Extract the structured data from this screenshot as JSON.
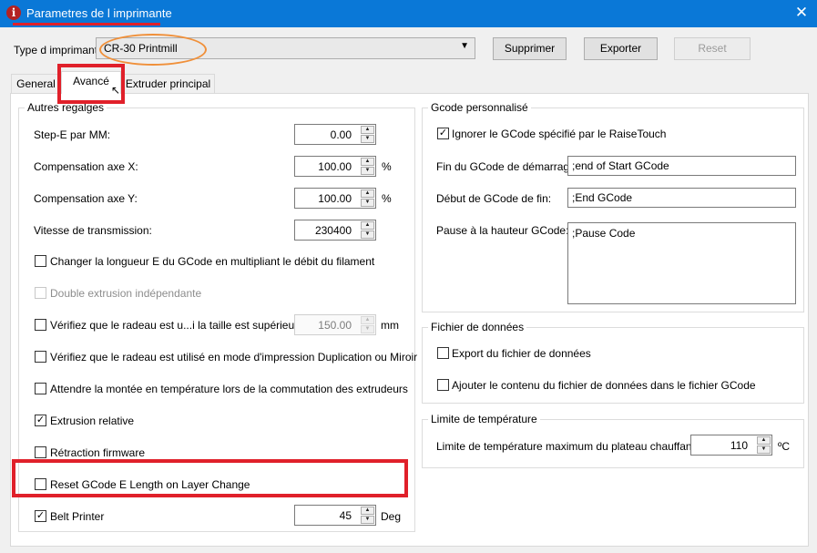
{
  "window": {
    "title": "Parametres de l imprimante",
    "close_glyph": "✕",
    "app_icon_glyph": "i"
  },
  "printer": {
    "label": "Type d imprimante:",
    "selected": "CR-30 Printmill"
  },
  "buttons": {
    "delete": "Supprimer",
    "export": "Exporter",
    "reset": "Reset"
  },
  "tabs": [
    {
      "label": "General"
    },
    {
      "label": "Avancé"
    },
    {
      "label": "Extruder principal"
    }
  ],
  "other_settings": {
    "legend": "Autres regalges",
    "step_e": {
      "label": "Step-E par MM:",
      "value": "0.00"
    },
    "comp_x": {
      "label": "Compensation axe X:",
      "value": "100.00",
      "unit": "%"
    },
    "comp_y": {
      "label": "Compensation axe Y:",
      "value": "100.00",
      "unit": "%"
    },
    "baud": {
      "label": "Vitesse de transmission:",
      "value": "230400"
    },
    "checkboxes": [
      {
        "label": "Changer la longueur E du GCode en multipliant le débit du filament",
        "checked": false,
        "enabled": true
      },
      {
        "label": "Double extrusion indépendante",
        "checked": false,
        "enabled": false
      },
      {
        "label": "Vérifiez que le radeau est u...i la taille est supérieure à",
        "checked": false,
        "enabled": true
      },
      {
        "label": "Vérifiez que le radeau est utilisé en mode d'impression Duplication ou Miroir",
        "checked": false,
        "enabled": true
      },
      {
        "label": "Attendre la montée en température lors de la commutation des extrudeurs",
        "checked": false,
        "enabled": true
      },
      {
        "label": "Extrusion relative",
        "checked": true,
        "enabled": true
      },
      {
        "label": "Rétraction firmware",
        "checked": false,
        "enabled": true
      },
      {
        "label": "Reset GCode E Length on Layer Change",
        "checked": false,
        "enabled": true
      }
    ],
    "raft_size": {
      "value": "150.00",
      "unit": "mm"
    },
    "belt_printer": {
      "label": "Belt Printer",
      "checked": true,
      "value": "45",
      "unit": "Deg"
    }
  },
  "gcode": {
    "legend": "Gcode personnalisé",
    "ignore": {
      "label": "Ignorer le GCode spécifié par le RaiseTouch",
      "checked": true
    },
    "end_of_start": {
      "label": "Fin du GCode de démarrage:",
      "value": ";end of Start GCode"
    },
    "start_of_end": {
      "label": "Début de GCode de fin:",
      "value": ";End GCode"
    },
    "pause": {
      "label": "Pause à la hauteur GCode:",
      "value": ";Pause Code"
    }
  },
  "datafile": {
    "legend": "Fichier de données",
    "export": {
      "label": "Export du fichier de données",
      "checked": false
    },
    "append": {
      "label": "Ajouter le contenu du fichier de données dans le fichier GCode",
      "checked": false
    }
  },
  "temp_limit": {
    "legend": "Limite de température",
    "label": "Limite de température maximum du plateau chauffant:",
    "value": "110",
    "unit": "ºC"
  },
  "glyphs": {
    "up": "▲",
    "down": "▼",
    "check": "✓",
    "caret": "▼",
    "cursor": "↖"
  },
  "accent_colors": {
    "titlebar": "#0a78d7",
    "highlight": "#e0202a",
    "oval": "#f0903a"
  }
}
